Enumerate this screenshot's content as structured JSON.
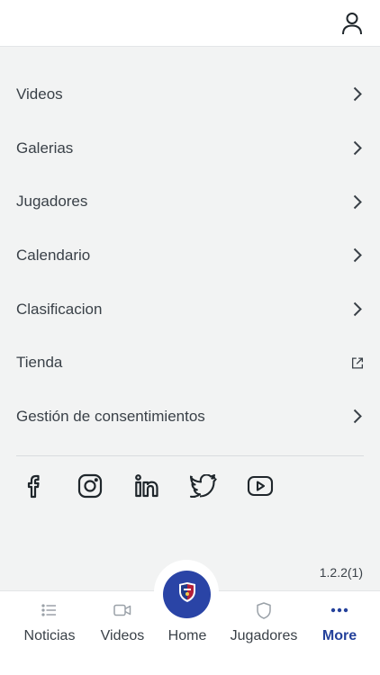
{
  "header": {
    "user_icon": "user-icon"
  },
  "menu": {
    "items": [
      {
        "label": "Videos",
        "icon": "chevron-right-icon"
      },
      {
        "label": "Galerias",
        "icon": "chevron-right-icon"
      },
      {
        "label": "Jugadores",
        "icon": "chevron-right-icon"
      },
      {
        "label": "Calendario",
        "icon": "chevron-right-icon"
      },
      {
        "label": "Clasificacion",
        "icon": "chevron-right-icon"
      },
      {
        "label": "Tienda",
        "icon": "external-link-icon"
      },
      {
        "label": "Gestión de consentimientos",
        "icon": "chevron-right-icon"
      }
    ]
  },
  "social": [
    "facebook-icon",
    "instagram-icon",
    "linkedin-icon",
    "twitter-icon",
    "youtube-icon"
  ],
  "version": "1.2.2(1)",
  "tabbar": {
    "tabs": [
      {
        "label": "Noticias",
        "icon": "list-icon",
        "active": false
      },
      {
        "label": "Videos",
        "icon": "video-icon",
        "active": false
      },
      {
        "label": "Home",
        "icon": "club-crest-icon",
        "active": false
      },
      {
        "label": "Jugadores",
        "icon": "shield-icon",
        "active": false
      },
      {
        "label": "More",
        "icon": "more-dots-icon",
        "active": true
      }
    ]
  },
  "colors": {
    "accent": "#24419b",
    "home_circle": "#2a44a6",
    "background": "#f2f3f3",
    "text": "#3a4148"
  }
}
